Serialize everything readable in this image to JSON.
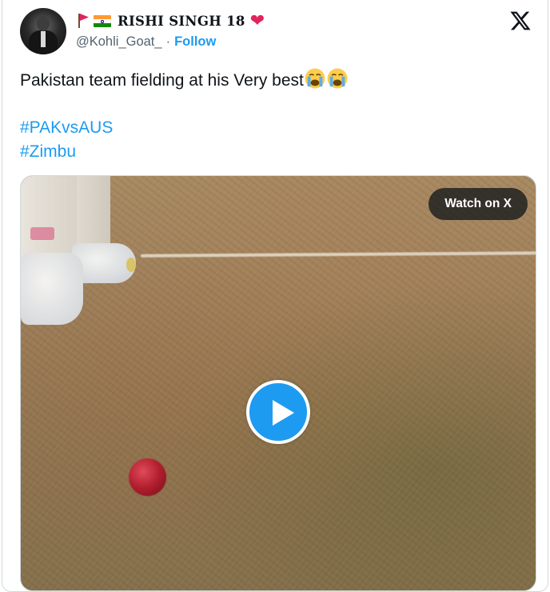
{
  "user": {
    "display_name": "RISHI SINGH 18",
    "handle": "@Kohli_Goat_",
    "separator": "·",
    "follow_label": "Follow",
    "name_emojis": [
      "triangular-flag-icon",
      "india-flag-icon"
    ],
    "heart": "❤"
  },
  "tweet": {
    "text": "Pakistan team fielding at his Very best",
    "trailing_emojis": [
      "loudly-crying-face-icon",
      "loudly-crying-face-icon"
    ],
    "hashtags": [
      "#PAKvsAUS",
      "#Zimbu"
    ]
  },
  "media": {
    "watch_label": "Watch on X",
    "play_icon": "play-icon"
  },
  "colors": {
    "link": "#1d9bf0",
    "text": "#0f1419",
    "muted": "#536471",
    "heart": "#e0245e"
  }
}
